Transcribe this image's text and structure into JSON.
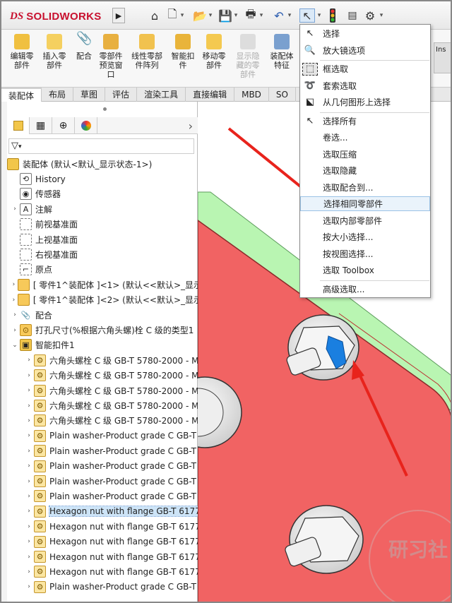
{
  "app": {
    "logo_prefix": "DS",
    "logo_text": "SOLIDWORKS"
  },
  "quick_access": {
    "icons": [
      "home-icon",
      "new-doc-icon",
      "open-icon",
      "save-icon",
      "print-icon",
      "undo-icon",
      "select-arrow-icon",
      "traffic-light-icon",
      "file-props-icon",
      "gear-icon"
    ]
  },
  "ribbon": {
    "buttons": [
      {
        "label": "编辑零\n部件"
      },
      {
        "label": "插入零\n部件"
      },
      {
        "label": "配合"
      },
      {
        "label": "零部件\n预览窗\n口"
      },
      {
        "label": "线性零部\n件阵列"
      },
      {
        "label": "智能扣\n件"
      },
      {
        "label": "移动零\n部件"
      },
      {
        "label": "显示隐\n藏的零\n部件"
      },
      {
        "label": "装配体\n特征"
      }
    ],
    "insert_stub": "Ins"
  },
  "tabs": [
    "装配体",
    "布局",
    "草图",
    "评估",
    "渲染工具",
    "直接编辑",
    "MBD",
    "SO"
  ],
  "tree": {
    "filter_icon": "▽",
    "root": "装配体 (默认<默认_显示状态-1>)",
    "items": [
      {
        "label": "History",
        "icon": "history",
        "exp": ""
      },
      {
        "label": "传感器",
        "icon": "sensor",
        "exp": ""
      },
      {
        "label": "注解",
        "icon": "annotation",
        "exp": "›"
      },
      {
        "label": "前视基准面",
        "icon": "plane",
        "exp": ""
      },
      {
        "label": "上视基准面",
        "icon": "plane",
        "exp": ""
      },
      {
        "label": "右视基准面",
        "icon": "plane",
        "exp": ""
      },
      {
        "label": "原点",
        "icon": "origin",
        "exp": ""
      },
      {
        "label": "[ 零件1^装配体 ]<1> (默认<<默认>_显示",
        "icon": "part",
        "exp": "›"
      },
      {
        "label": "[ 零件1^装配体 ]<2> (默认<<默认>_显示",
        "icon": "part",
        "exp": "›"
      },
      {
        "label": "配合",
        "icon": "mate",
        "exp": "›"
      },
      {
        "label": "打孔尺寸(%根据六角头螺)栓 C 级的类型1",
        "icon": "hole",
        "exp": "›"
      },
      {
        "label": "智能扣件1",
        "icon": "fastener",
        "exp": "⌄"
      }
    ],
    "fasteners": [
      "六角头螺栓 C 级 GB-T 5780-2000 - M",
      "六角头螺栓 C 级 GB-T 5780-2000 - M",
      "六角头螺栓 C 级 GB-T 5780-2000 - M",
      "六角头螺栓 C 级 GB-T 5780-2000 - M",
      "六角头螺栓 C 级 GB-T 5780-2000 - M",
      "Plain washer-Product grade C GB-T",
      "Plain washer-Product grade C GB-T",
      "Plain washer-Product grade C GB-T",
      "Plain washer-Product grade C GB-T",
      "Plain washer-Product grade C GB-T",
      "Hexagon nut with flange GB-T 6177",
      "Hexagon nut with flange GB-T 6177",
      "Hexagon nut with flange GB-T 6177",
      "Hexagon nut with flange GB-T 6177",
      "Hexagon nut with flange GB-T 6177",
      "Plain washer-Product grade C GB-T"
    ],
    "selected_fastener_index": 10
  },
  "menu": {
    "items": [
      {
        "label": "选择",
        "icon": "select-arrow-icon",
        "glyph": "↖"
      },
      {
        "label": "放大镜选项",
        "icon": "magnifier-icon",
        "glyph": "🔍"
      },
      {
        "sep": true
      },
      {
        "label": "框选取",
        "icon": "box-select-icon",
        "glyph": "⬚"
      },
      {
        "label": "套索选取",
        "icon": "lasso-icon",
        "glyph": "➰"
      },
      {
        "label": "从几何图形上选择",
        "icon": "geometry-select-icon",
        "glyph": "⬕"
      },
      {
        "sep": true
      },
      {
        "label": "选择所有",
        "icon": "select-all-icon",
        "glyph": "↖"
      },
      {
        "label": "卷选...",
        "icon": "",
        "glyph": ""
      },
      {
        "label": "选取压缩",
        "icon": "",
        "glyph": ""
      },
      {
        "label": "选取隐藏",
        "icon": "",
        "glyph": ""
      },
      {
        "label": "选取配合到...",
        "icon": "",
        "glyph": ""
      },
      {
        "label": "选择相同零部件",
        "icon": "",
        "glyph": ""
      },
      {
        "label": "选取内部零部件",
        "icon": "",
        "glyph": ""
      },
      {
        "label": "按大小选择...",
        "icon": "",
        "glyph": ""
      },
      {
        "label": "按视图选择...",
        "icon": "",
        "glyph": ""
      },
      {
        "label": "选取 Toolbox",
        "icon": "",
        "glyph": ""
      },
      {
        "sep": true
      },
      {
        "label": "高级选取...",
        "icon": "",
        "glyph": ""
      }
    ],
    "highlighted": "选择相同零部件"
  },
  "colors": {
    "plate_red": "#f16363",
    "plate_green": "#b9f5b2",
    "bolt_selected": "#1a7fe0",
    "arrow_red": "#e8231c",
    "accent": "#c8102e"
  },
  "watermark": "研习社"
}
